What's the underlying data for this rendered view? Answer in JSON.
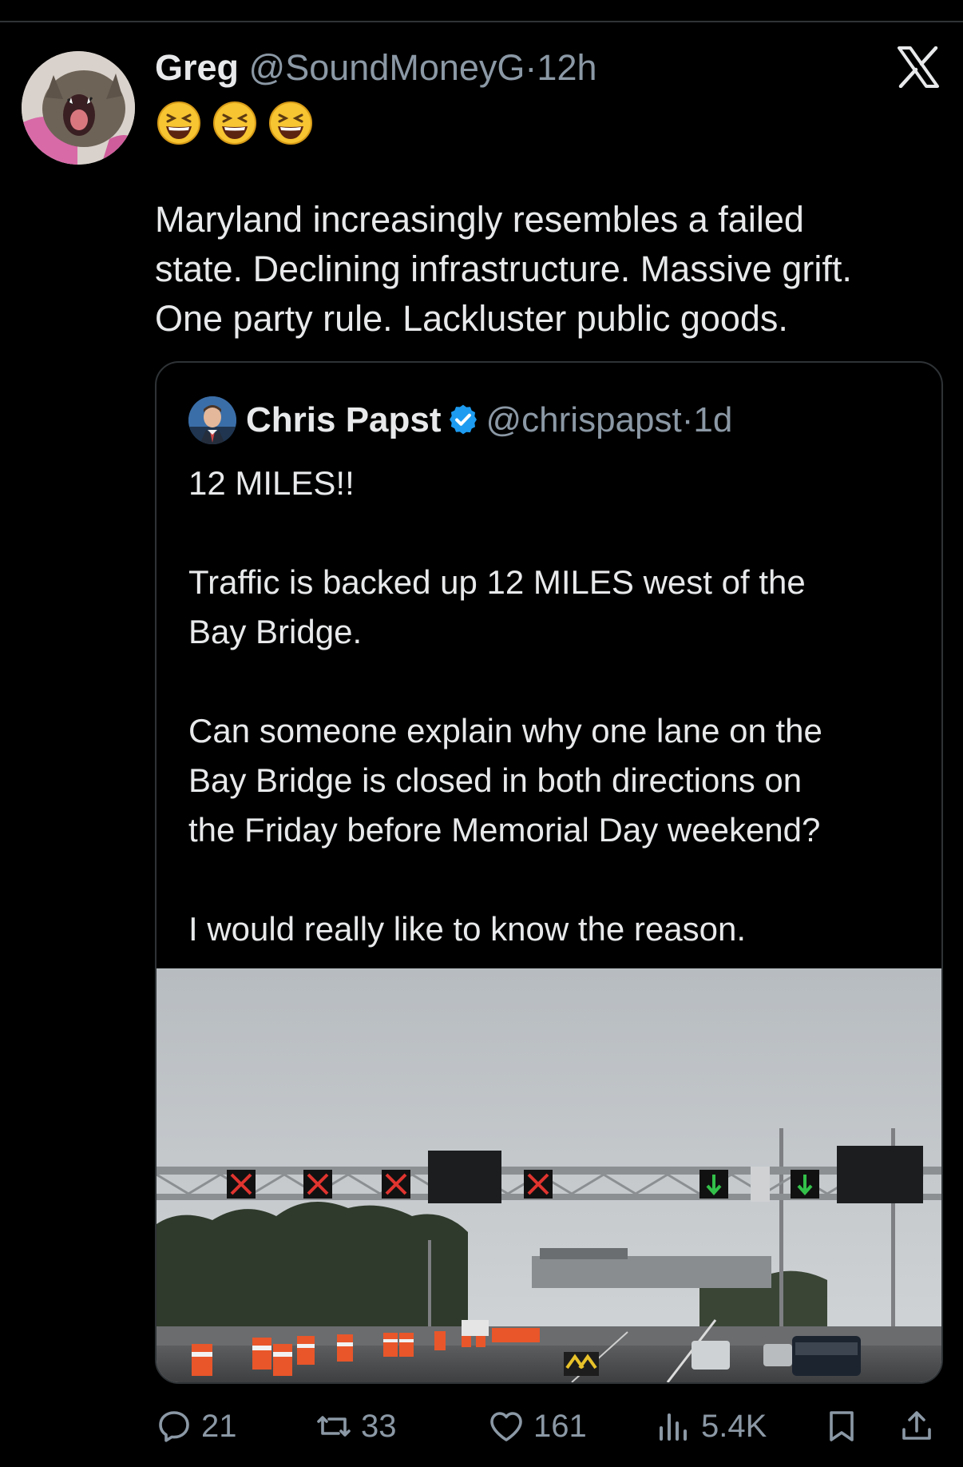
{
  "post": {
    "author_name": "Greg",
    "author_handle": "@SoundMoneyG",
    "separator": "·",
    "time": "12h",
    "emoji_line": [
      "grinning-squinting-face",
      "grinning-squinting-face",
      "grinning-squinting-face"
    ],
    "text_lines": [
      "Maryland increasingly resembles a failed",
      "state. Declining infrastructure.  Massive grift.",
      "One party rule. Lackluster public goods."
    ]
  },
  "quoted": {
    "author_name": "Chris Papst",
    "author_handle": "@chrispapst",
    "separator": "·",
    "time": "1d",
    "verified": true,
    "paragraphs": [
      [
        "12 MILES!!"
      ],
      [
        "Traffic is backed up 12 MILES west of the",
        "Bay Bridge."
      ],
      [
        "Can someone explain why one lane on the",
        "Bay Bridge is closed in both directions on",
        "the Friday before Memorial Day weekend?"
      ],
      [
        "I would really like to know the reason."
      ]
    ],
    "photo_description_icons": [
      "lane-closed-x",
      "lane-open-arrow"
    ]
  },
  "actions": {
    "replies": "21",
    "reposts": "33",
    "likes": "161",
    "views": "5.4K"
  },
  "colors": {
    "background": "#000000",
    "text": "#e7e9ea",
    "muted": "#8b98a5",
    "border": "#2f3336",
    "verified": "#1d9bf0"
  }
}
